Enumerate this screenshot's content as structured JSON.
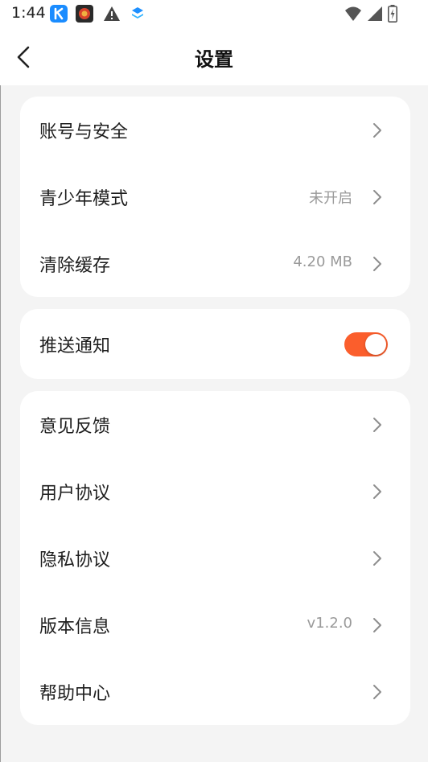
{
  "status_bar": {
    "time": "1:44",
    "left_icons": [
      "k-app-icon",
      "red-app-icon",
      "warning-icon",
      "layers-app-icon"
    ],
    "right_icons": [
      "wifi-icon",
      "cell-signal-icon",
      "battery-charging-icon"
    ]
  },
  "header": {
    "title": "设置",
    "back_icon": "chevron-left-icon"
  },
  "groups": [
    {
      "items": [
        {
          "label": "账号与安全",
          "value": ""
        },
        {
          "label": "青少年模式",
          "value": "未开启"
        },
        {
          "label": "清除缓存",
          "value": "4.20 MB"
        }
      ]
    },
    {
      "items": [
        {
          "label": "推送通知",
          "toggle_on": true
        }
      ]
    },
    {
      "items": [
        {
          "label": "意见反馈",
          "value": ""
        },
        {
          "label": "用户协议",
          "value": ""
        },
        {
          "label": "隐私协议",
          "value": ""
        },
        {
          "label": "版本信息",
          "value": "v1.2.0"
        },
        {
          "label": "帮助中心",
          "value": ""
        }
      ]
    }
  ],
  "colors": {
    "accent": "#fb5e2c",
    "background": "#f4f4f4",
    "card": "#ffffff",
    "secondary_text": "#9a9a9a"
  }
}
